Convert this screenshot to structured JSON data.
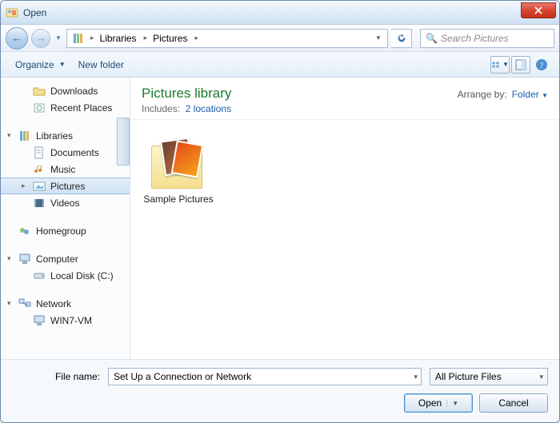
{
  "window": {
    "title": "Open"
  },
  "nav": {
    "breadcrumb": [
      "Libraries",
      "Pictures"
    ],
    "search_placeholder": "Search Pictures"
  },
  "toolbar": {
    "organize": "Organize",
    "newfolder": "New folder"
  },
  "sidebar": {
    "downloads": "Downloads",
    "recent": "Recent Places",
    "libraries": "Libraries",
    "documents": "Documents",
    "music": "Music",
    "pictures": "Pictures",
    "videos": "Videos",
    "homegroup": "Homegroup",
    "computer": "Computer",
    "localdisk": "Local Disk (C:)",
    "network": "Network",
    "win7vm": "WIN7-VM"
  },
  "library": {
    "title": "Pictures library",
    "includes_label": "Includes:",
    "includes_link": "2 locations",
    "arrange_label": "Arrange by:",
    "arrange_value": "Folder"
  },
  "content": {
    "item1": "Sample Pictures"
  },
  "footer": {
    "filename_label": "File name:",
    "filename_value": "Set Up a Connection or Network",
    "filter": "All Picture Files",
    "open": "Open",
    "cancel": "Cancel"
  }
}
